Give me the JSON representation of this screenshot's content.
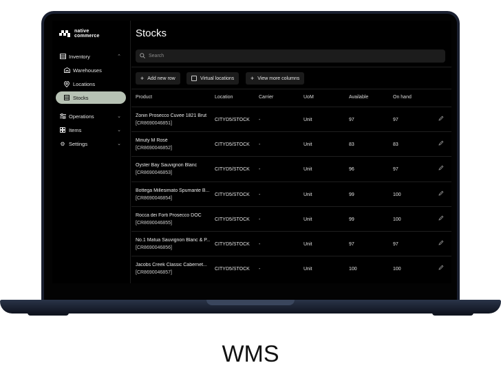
{
  "brand": {
    "name_line1": "native",
    "name_line2": "commerce"
  },
  "sidebar": {
    "items": [
      {
        "label": "Inventory",
        "icon": "inventory-icon",
        "chevron": "up"
      },
      {
        "label": "Warehouses",
        "icon": "warehouse-icon"
      },
      {
        "label": "Locations",
        "icon": "location-pin-icon"
      },
      {
        "label": "Stocks",
        "icon": "stocks-icon",
        "active": true
      },
      {
        "label": "Operations",
        "icon": "operations-icon",
        "chevron": "down"
      },
      {
        "label": "Items",
        "icon": "items-grid-icon",
        "chevron": "down"
      },
      {
        "label": "Settings",
        "icon": "gear-icon",
        "chevron": "down"
      }
    ]
  },
  "main": {
    "title": "Stocks",
    "search_placeholder": "Search",
    "toolbar": {
      "add_row": "Add new row",
      "virtual_locations": "Virtual locations",
      "view_more_columns": "View more columns"
    },
    "columns": [
      "Product",
      "Location",
      "Carrier",
      "UoM",
      "Available",
      "On hand"
    ],
    "rows": [
      {
        "name": "Zonin Prosecco Cuvee 1821 Brut",
        "sku": "[CR8690046851]",
        "location": "CITYD5/STOCK",
        "carrier": "-",
        "uom": "Unit",
        "available": "97",
        "on_hand": "97"
      },
      {
        "name": "Minuty M Rosé",
        "sku": "[CR8690046852]",
        "location": "CITYD5/STOCK",
        "carrier": "-",
        "uom": "Unit",
        "available": "83",
        "on_hand": "83"
      },
      {
        "name": "Oyster Bay Sauvignon Blanc",
        "sku": "[CR8690046853]",
        "location": "CITYD5/STOCK",
        "carrier": "-",
        "uom": "Unit",
        "available": "96",
        "on_hand": "97"
      },
      {
        "name": "Bottega Millesimato Spumante B...",
        "sku": "[CR8690046854]",
        "location": "CITYD5/STOCK",
        "carrier": "-",
        "uom": "Unit",
        "available": "99",
        "on_hand": "100"
      },
      {
        "name": "Rocca dei Forti Prosecco DOC",
        "sku": "[CR8690046855]",
        "location": "CITYD5/STOCK",
        "carrier": "-",
        "uom": "Unit",
        "available": "99",
        "on_hand": "100"
      },
      {
        "name": "No.1 Matua Sauvignon Blanc & P...",
        "sku": "[CR8690046856]",
        "location": "CITYD5/STOCK",
        "carrier": "-",
        "uom": "Unit",
        "available": "97",
        "on_hand": "97"
      },
      {
        "name": "Jacobs Creek Classic Cabernet...",
        "sku": "[CR8690046857]",
        "location": "CITYD5/STOCK",
        "carrier": "-",
        "uom": "Unit",
        "available": "100",
        "on_hand": "100"
      }
    ]
  },
  "caption": "WMS",
  "colors": {
    "active_nav_bg": "#b7c2b4",
    "screen_bg": "#000000",
    "laptop_body": "#1a2030"
  }
}
